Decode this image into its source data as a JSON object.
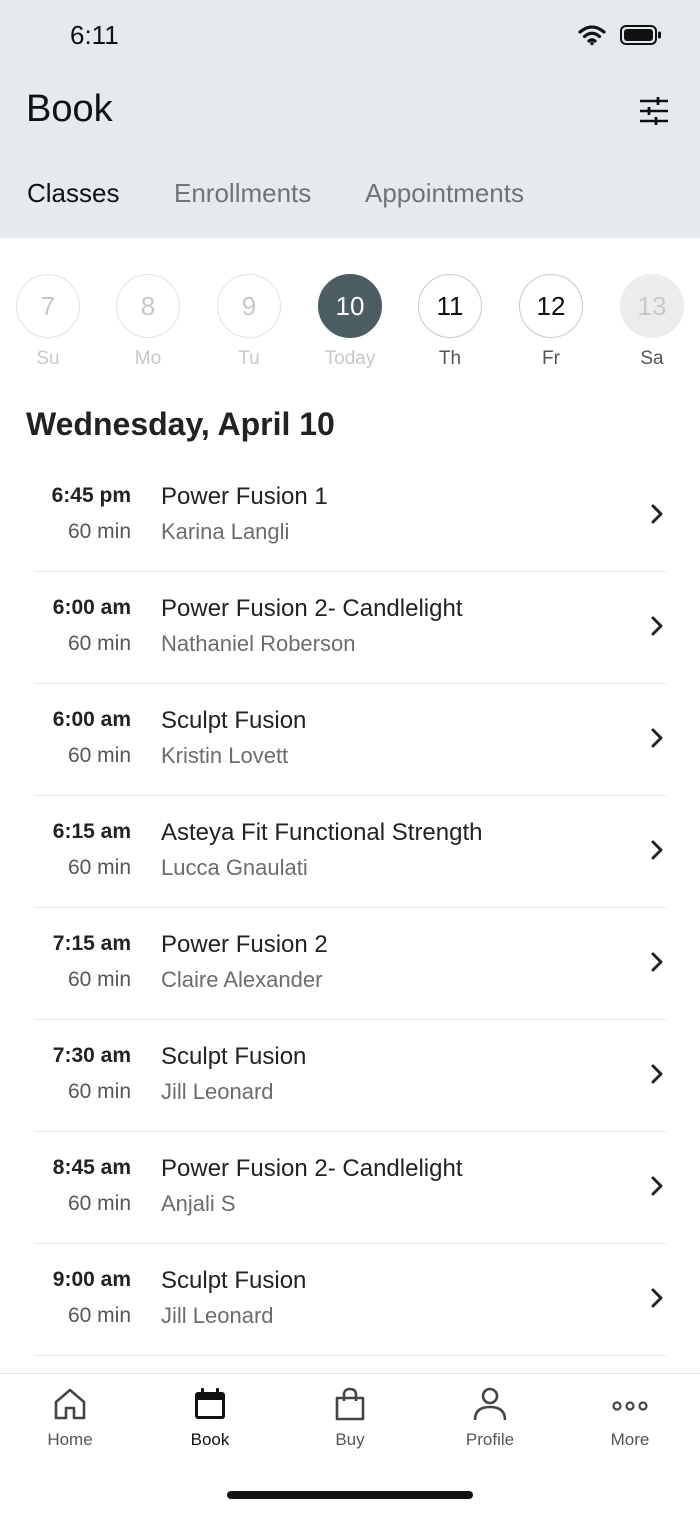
{
  "status": {
    "time": "6:11"
  },
  "header": {
    "title": "Book"
  },
  "tabs": [
    {
      "label": "Classes",
      "active": true
    },
    {
      "label": "Enrollments",
      "active": false
    },
    {
      "label": "Appointments",
      "active": false
    }
  ],
  "days": [
    {
      "num": "7",
      "label": "Su"
    },
    {
      "num": "8",
      "label": "Mo"
    },
    {
      "num": "9",
      "label": "Tu"
    },
    {
      "num": "10",
      "label": "Today"
    },
    {
      "num": "11",
      "label": "Th"
    },
    {
      "num": "12",
      "label": "Fr"
    },
    {
      "num": "13",
      "label": "Sa"
    }
  ],
  "date_heading": "Wednesday, April 10",
  "classes": [
    {
      "time": "6:45 pm",
      "duration": "60 min",
      "name": "Power Fusion 1",
      "instructor": "Karina Langli"
    },
    {
      "time": "6:00 am",
      "duration": "60 min",
      "name": "Power Fusion 2- Candlelight",
      "instructor": "Nathaniel Roberson"
    },
    {
      "time": "6:00 am",
      "duration": "60 min",
      "name": "Sculpt Fusion",
      "instructor": "Kristin Lovett"
    },
    {
      "time": "6:15 am",
      "duration": "60 min",
      "name": "Asteya Fit Functional Strength",
      "instructor": "Lucca Gnaulati"
    },
    {
      "time": "7:15 am",
      "duration": "60 min",
      "name": "Power Fusion 2",
      "instructor": "Claire Alexander"
    },
    {
      "time": "7:30 am",
      "duration": "60 min",
      "name": "Sculpt Fusion",
      "instructor": "Jill Leonard"
    },
    {
      "time": "8:45 am",
      "duration": "60 min",
      "name": "Power Fusion 2- Candlelight",
      "instructor": "Anjali S"
    },
    {
      "time": "9:00 am",
      "duration": "60 min",
      "name": "Sculpt Fusion",
      "instructor": "Jill Leonard"
    }
  ],
  "tabbar": [
    {
      "label": "Home",
      "icon": "home-icon"
    },
    {
      "label": "Book",
      "icon": "calendar-icon"
    },
    {
      "label": "Buy",
      "icon": "shopping-bag-icon"
    },
    {
      "label": "Profile",
      "icon": "person-icon"
    },
    {
      "label": "More",
      "icon": "more-dots-icon"
    }
  ],
  "colors": {
    "header_bg": "#e4eaed",
    "today_circle": "#4b5c63"
  }
}
